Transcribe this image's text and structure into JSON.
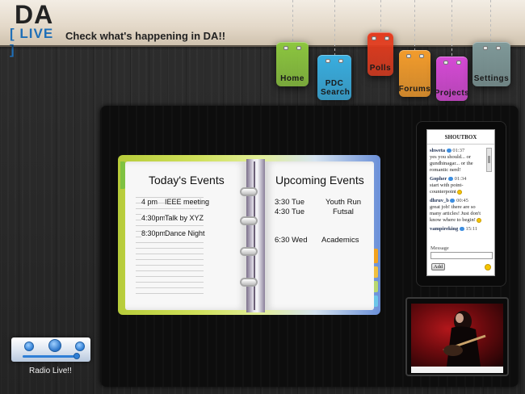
{
  "header": {
    "logo_text": "DA",
    "logo_sub": "[ LIVE ]",
    "tagline": "Check what's happening in DA!!"
  },
  "nav": [
    {
      "label": "Home",
      "color": "#8cc63f"
    },
    {
      "label": "PDC Search",
      "color": "#39aee0"
    },
    {
      "label": "Polls",
      "color": "#e23b1e"
    },
    {
      "label": "Forums",
      "color": "#f39c2c"
    },
    {
      "label": "Projects",
      "color": "#d64ad6"
    },
    {
      "label": "Settings",
      "color": "#7f9999"
    }
  ],
  "planner": {
    "left_title": "Today's Events",
    "right_title": "Upcoming Events",
    "today": [
      {
        "time": "4 pm",
        "event": "IEEE meeting"
      },
      {
        "time": "4:30pm",
        "event": "Talk by XYZ"
      },
      {
        "time": "8:30pm",
        "event": "Dance Night"
      }
    ],
    "upcoming": [
      {
        "time": "3:30 Tue",
        "event": "Youth Run"
      },
      {
        "time": "4:30 Tue",
        "event": "Futsal"
      },
      {
        "time": "6:30 Wed",
        "event": "Academics"
      }
    ]
  },
  "shoutbox": {
    "title": "SHOUTBOX",
    "messages": [
      {
        "user": "shweta",
        "time": "01:37",
        "text": "yes you should... or gundhinagar... or the romantic nerd!"
      },
      {
        "user": "Gopher",
        "time": "01:34",
        "text": "start with point-counterpoint"
      },
      {
        "user": "dhruv_b",
        "time": "00:45",
        "text": "great job! there are so many articles! Just don't know where to begin!"
      },
      {
        "user": "vampireking",
        "time": "15:11",
        "text": ""
      }
    ],
    "message_label": "Message",
    "add_label": "Add"
  },
  "radio": {
    "label": "Radio Live!!",
    "progress": 0.95
  }
}
